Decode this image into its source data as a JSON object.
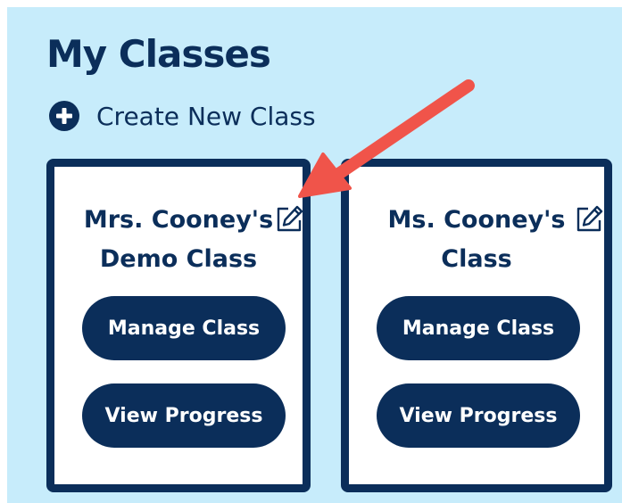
{
  "header": {
    "title": "My Classes",
    "create_label": "Create New Class"
  },
  "classes": [
    {
      "name_line1": "Mrs. Cooney's",
      "name_line2": "Demo Class",
      "manage_label": "Manage Class",
      "progress_label": "View Progress"
    },
    {
      "name_line1": "Ms. Cooney's",
      "name_line2": "Class",
      "manage_label": "Manage Class",
      "progress_label": "View Progress"
    }
  ],
  "icons": {
    "create": "plus-circle-icon",
    "edit": "pencil-square-icon",
    "annotation": "red-arrow-annotation"
  },
  "colors": {
    "background": "#c7ecfb",
    "primary": "#0b2e5a",
    "card": "#ffffff",
    "annotation": "#f0544a"
  }
}
